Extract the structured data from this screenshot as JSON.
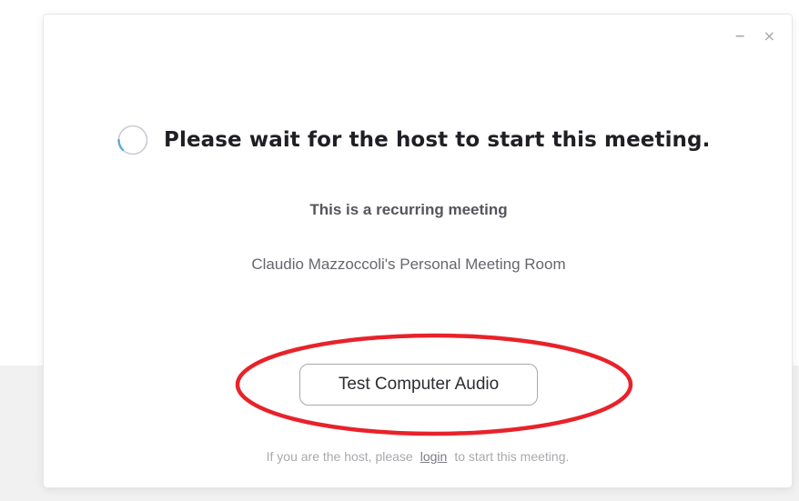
{
  "window_controls": {
    "minimize_glyph": "–",
    "close_glyph": "×"
  },
  "status": {
    "spinner_icon": "loading-spinner-icon",
    "headline": "Please wait for the host to start this meeting.",
    "subtitle": "This is a recurring meeting",
    "room_name": "Claudio Mazzoccoli's Personal Meeting Room"
  },
  "actions": {
    "test_audio_label": "Test Computer Audio"
  },
  "footer": {
    "prefix": "If you are the host, please",
    "link_label": "login",
    "suffix": "to start this meeting."
  },
  "colors": {
    "spinner_track": "#c9ccd3",
    "spinner_arc": "#5aa9d8",
    "annotation": "#e8222a",
    "headline": "#1f1f24"
  }
}
